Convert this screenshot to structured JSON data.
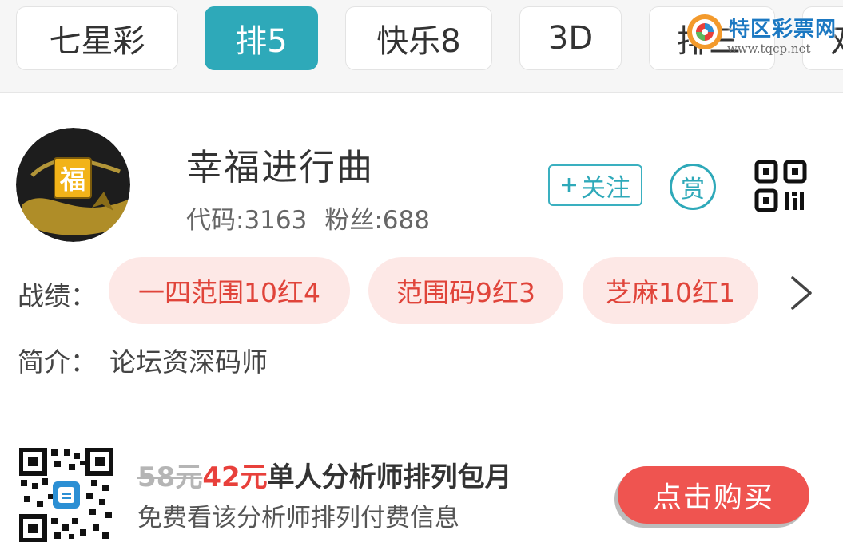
{
  "tabs": [
    {
      "label": "七星彩",
      "active": false
    },
    {
      "label": "排5",
      "active": true
    },
    {
      "label": "快乐8",
      "active": false
    },
    {
      "label": "3D",
      "active": false
    },
    {
      "label": "排三",
      "active": false
    },
    {
      "label": "双",
      "active": false
    }
  ],
  "watermark": {
    "title": "特区彩票网",
    "url": "www.tqcp.net"
  },
  "profile": {
    "name": "幸福进行曲",
    "code": "代码:3163",
    "fans": "粉丝:688",
    "avatar_text": "福",
    "follow_label": "关注",
    "follow_icon": "plus-icon",
    "reward_label": "赏",
    "qr_icon": "qr-code-icon"
  },
  "record": {
    "label": "战绩：",
    "items": [
      "一四范围10红4",
      "范围码9红3",
      "芝麻10红1"
    ],
    "more_icon": "chevron-right-icon"
  },
  "intro": {
    "label": "简介：",
    "text": "论坛资深码师"
  },
  "promo": {
    "old_price": "58元",
    "new_price": "42元",
    "title": "单人分析师排列包月",
    "subtitle": "免费看该分析师排列付费信息",
    "buy_label": "点击购买"
  },
  "colors": {
    "accent": "#2ea9b9",
    "pill_bg": "#fde8e6",
    "pill_text": "#e0443a",
    "buy": "#ef5450",
    "price": "#e8403b"
  }
}
